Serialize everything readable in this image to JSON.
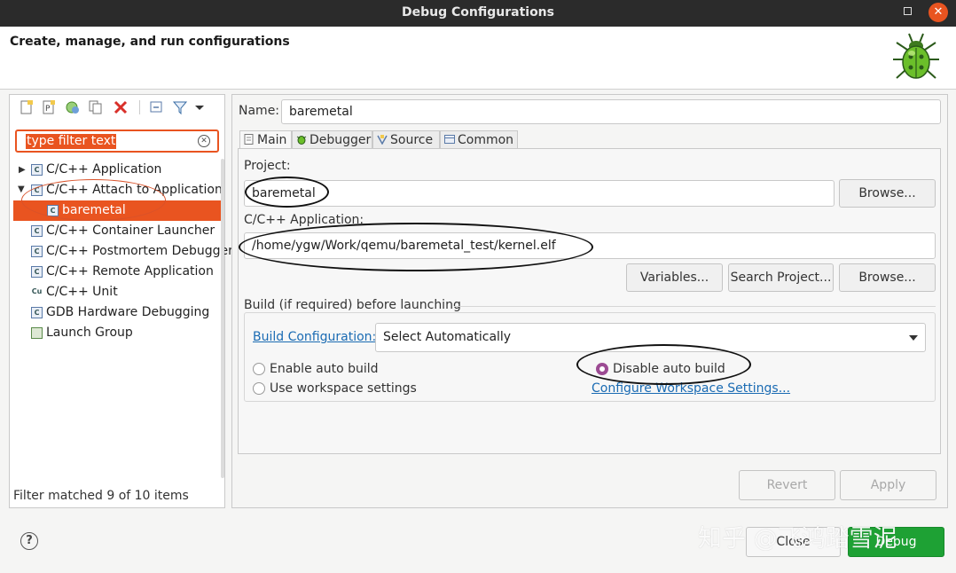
{
  "window": {
    "title": "Debug Configurations"
  },
  "header": {
    "title": "Create, manage, and run configurations"
  },
  "sidebar": {
    "filter": {
      "placeholder": "type filter text"
    },
    "tree": [
      {
        "label": "C/C++ Application",
        "icon": "c-config-icon",
        "expanded": false
      },
      {
        "label": "C/C++ Attach to Application",
        "icon": "c-config-icon",
        "expanded": true
      },
      {
        "label": "baremetal",
        "icon": "c-config-icon",
        "selected": true
      },
      {
        "label": "C/C++ Container Launcher",
        "icon": "c-config-icon"
      },
      {
        "label": "C/C++ Postmortem Debugger",
        "icon": "c-config-icon"
      },
      {
        "label": "C/C++ Remote Application",
        "icon": "c-config-icon"
      },
      {
        "label": "C/C++ Unit",
        "icon": "c-unit-icon"
      },
      {
        "label": "GDB Hardware Debugging",
        "icon": "c-config-icon"
      },
      {
        "label": "Launch Group",
        "icon": "launch-group-icon"
      }
    ],
    "status": "Filter matched 9 of 10 items"
  },
  "main": {
    "name_label": "Name:",
    "name_value": "baremetal",
    "tabs": [
      {
        "label": "Main",
        "active": true
      },
      {
        "label": "Debugger"
      },
      {
        "label": "Source"
      },
      {
        "label": "Common"
      }
    ],
    "project_label": "Project:",
    "project_value": "baremetal",
    "browse_label": "Browse...",
    "app_label": "C/C++ Application:",
    "app_value": "/home/ygw/Work/qemu/baremetal_test/kernel.elf",
    "variables_label": "Variables...",
    "search_project_label": "Search Project...",
    "browse2_label": "Browse...",
    "build_group_label": "Build (if required) before launching",
    "build_config_link": "Build Configuration:",
    "build_config_value": "Select Automatically",
    "enable_auto_build": "Enable auto build",
    "disable_auto_build": "Disable auto build",
    "use_workspace": "Use workspace settings",
    "configure_workspace_link": "Configure Workspace Settings...",
    "revert_label": "Revert",
    "apply_label": "Apply"
  },
  "footer": {
    "help": "?",
    "close_label": "Close",
    "debug_label": "Debug"
  },
  "watermark": "知乎 @飞鸿踏雪泥",
  "colors": {
    "accent": "#e95420",
    "radio": "#9c4b93",
    "link": "#1a6bb3",
    "debug_button": "#1ea134"
  }
}
